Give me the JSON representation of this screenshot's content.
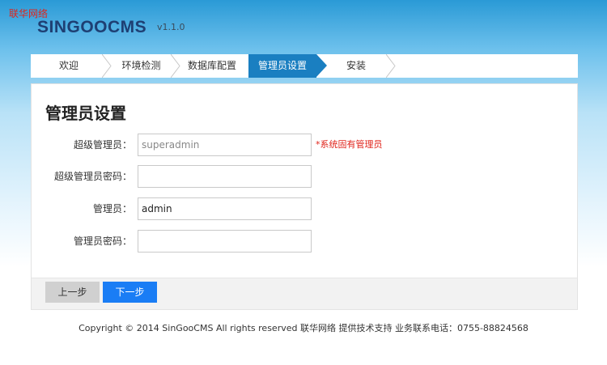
{
  "corner_brand": "联华网络",
  "logo": {
    "name": "SINGOOCMS",
    "version": "v1.1.0"
  },
  "steps": [
    {
      "label": "欢迎",
      "active": false
    },
    {
      "label": "环境检测",
      "active": false
    },
    {
      "label": "数据库配置",
      "active": false
    },
    {
      "label": "管理员设置",
      "active": true
    },
    {
      "label": "安装",
      "active": false
    }
  ],
  "panel": {
    "title": "管理员设置",
    "fields": {
      "super_admin": {
        "label": "超级管理员：",
        "value": "superadmin",
        "hint": "*系统固有管理员"
      },
      "super_admin_password": {
        "label": "超级管理员密码：",
        "value": ""
      },
      "admin": {
        "label": "管理员：",
        "value": "admin"
      },
      "admin_password": {
        "label": "管理员密码：",
        "value": ""
      }
    }
  },
  "buttons": {
    "prev": "上一步",
    "next": "下一步"
  },
  "colors": {
    "accent": "#1a7fc1",
    "next_button": "#1a7df5",
    "hint": "#e0241b"
  },
  "copyright": "Copyright © 2014 SinGooCMS All rights reserved 联华网络 提供技术支持 业务联系电话：0755-88824568"
}
